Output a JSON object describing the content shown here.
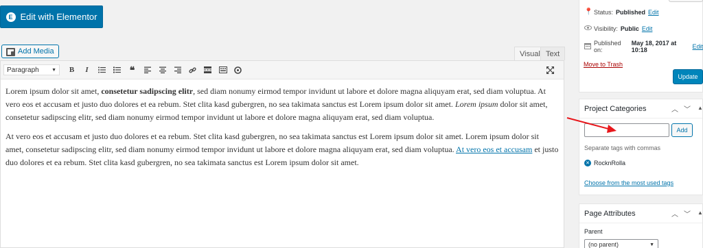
{
  "elementor": {
    "label": "Edit with Elementor",
    "icon": "elementor-icon"
  },
  "media": {
    "add_label": "Add Media"
  },
  "editor": {
    "tabs": [
      {
        "label": "Visual"
      },
      {
        "label": "Text"
      }
    ],
    "format_value": "Paragraph",
    "toolbar_icons": [
      "bold-icon",
      "italic-icon",
      "bullet-list-icon",
      "numbered-list-icon",
      "blockquote-icon",
      "align-left-icon",
      "align-center-icon",
      "align-right-icon",
      "link-icon",
      "read-more-icon",
      "toolbar-toggle-icon",
      "wordpress-icon",
      "fullscreen-icon"
    ],
    "toolbar_glyphs": {
      "bold": "B",
      "italic": "I",
      "quote": "❝"
    },
    "p1": {
      "a": "Lorem ipsum dolor sit amet, ",
      "b": "consetetur sadipscing elitr",
      "c": ", sed diam nonumy eirmod tempor invidunt ut labore et dolore magna aliquyam erat, sed diam voluptua. At vero eos et accusam et justo duo dolores et ea rebum. Stet clita kasd gubergren, no sea takimata sanctus est Lorem ipsum dolor sit amet. ",
      "d": "Lorem ipsum",
      "e": " dolor sit amet, consetetur sadipscing elitr, sed diam nonumy eirmod tempor invidunt ut labore et dolore magna aliquyam erat, sed diam voluptua."
    },
    "p2": {
      "a": "At vero eos et accusam et justo duo dolores et ea rebum. Stet clita kasd gubergren, no sea takimata sanctus est Lorem ipsum dolor sit amet. Lorem ipsum dolor sit amet, consetetur sadipscing elitr, sed diam nonumy eirmod tempor invidunt ut labore et dolore magna aliquyam erat, sed diam voluptua. ",
      "link": "At vero eos et accusam",
      "b": " et justo duo dolores et ea rebum. Stet clita kasd gubergren, no sea takimata sanctus est Lorem ipsum dolor sit amet."
    }
  },
  "publish": {
    "status_label": "Status:",
    "status_value": "Published",
    "status_edit": "Edit",
    "visibility_label": "Visibility:",
    "visibility_value": "Public",
    "visibility_edit": "Edit",
    "published_label": "Published on:",
    "published_value": "May 18, 2017 at 10:18",
    "published_edit": "Edit",
    "trash": "Move to Trash",
    "update": "Update"
  },
  "categories": {
    "title": "Project Categories",
    "add": "Add",
    "hint": "Separate tags with commas",
    "tag": "RocknRolla",
    "most_used": "Choose from the most used tags"
  },
  "attributes": {
    "title": "Page Attributes",
    "parent_label": "Parent",
    "parent_value": "(no parent)"
  },
  "colors": {
    "primary": "#0073aa",
    "update": "#0085ba",
    "trash": "#a00000",
    "arrow": "#e8171c"
  }
}
